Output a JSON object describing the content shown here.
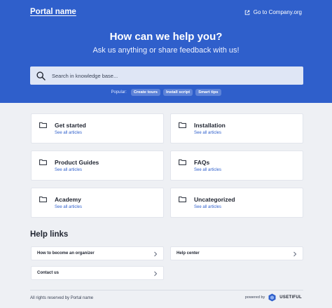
{
  "header": {
    "portal_name": "Portal name",
    "company_link": "Go to Company.org"
  },
  "hero": {
    "title": "How can we help you?",
    "subtitle": "Ask us anything or share feedback with us!",
    "search_placeholder": "Search in knowledge base...",
    "popular_label": "Popular:",
    "popular_tags": [
      "Create tours",
      "Install script",
      "Smart tips"
    ]
  },
  "categories": [
    {
      "title": "Get started",
      "link": "See all articles"
    },
    {
      "title": "Installation",
      "link": "See all articles"
    },
    {
      "title": "Product Guides",
      "link": "See all articles"
    },
    {
      "title": "FAQs",
      "link": "See all articles"
    },
    {
      "title": "Academy",
      "link": "See all articles"
    },
    {
      "title": "Uncategorized",
      "link": "See all articles"
    }
  ],
  "help": {
    "heading": "Help links",
    "links": [
      "How to become an organizer",
      "Help center",
      "Contact us"
    ]
  },
  "footer": {
    "copyright": "All rights reserved by Portal name",
    "powered_by": "powered by",
    "brand": "USETIFUL"
  },
  "colors": {
    "hero_bg": "#2f5fcb",
    "page_bg": "#eef0f4",
    "link": "#2f5fcb",
    "chip_bg": "#5d83d8"
  },
  "icons": {
    "external": "external-link-icon",
    "search": "search-icon",
    "folder": "folder-icon",
    "chevron": "chevron-right-icon",
    "brand": "usetiful-logo-icon"
  }
}
